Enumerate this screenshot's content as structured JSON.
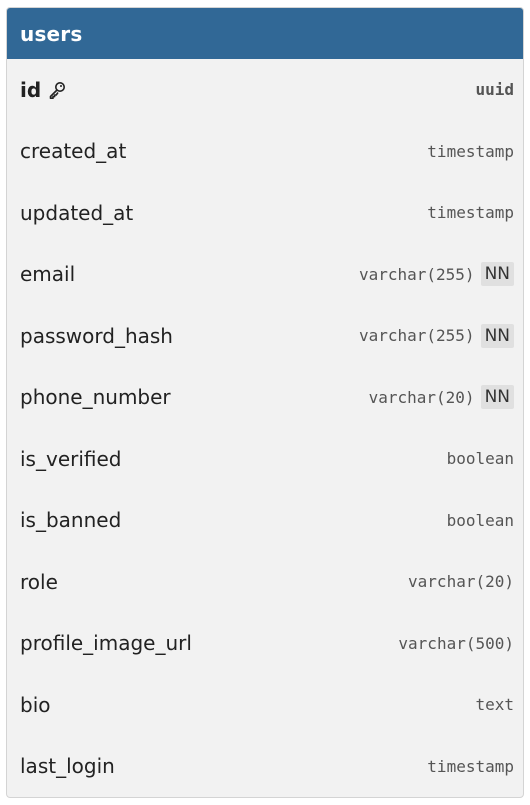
{
  "table": {
    "name": "users",
    "header_color": "#316896",
    "columns": [
      {
        "name": "id",
        "type": "uuid",
        "primary_key": true,
        "not_null": false,
        "icon": "key-icon"
      },
      {
        "name": "created_at",
        "type": "timestamp",
        "primary_key": false,
        "not_null": false
      },
      {
        "name": "updated_at",
        "type": "timestamp",
        "primary_key": false,
        "not_null": false
      },
      {
        "name": "email",
        "type": "varchar(255)",
        "primary_key": false,
        "not_null": true,
        "badge": "NN"
      },
      {
        "name": "password_hash",
        "type": "varchar(255)",
        "primary_key": false,
        "not_null": true,
        "badge": "NN"
      },
      {
        "name": "phone_number",
        "type": "varchar(20)",
        "primary_key": false,
        "not_null": true,
        "badge": "NN"
      },
      {
        "name": "is_verified",
        "type": "boolean",
        "primary_key": false,
        "not_null": false
      },
      {
        "name": "is_banned",
        "type": "boolean",
        "primary_key": false,
        "not_null": false
      },
      {
        "name": "role",
        "type": "varchar(20)",
        "primary_key": false,
        "not_null": false
      },
      {
        "name": "profile_image_url",
        "type": "varchar(500)",
        "primary_key": false,
        "not_null": false
      },
      {
        "name": "bio",
        "type": "text",
        "primary_key": false,
        "not_null": false
      },
      {
        "name": "last_login",
        "type": "timestamp",
        "primary_key": false,
        "not_null": false
      }
    ]
  }
}
